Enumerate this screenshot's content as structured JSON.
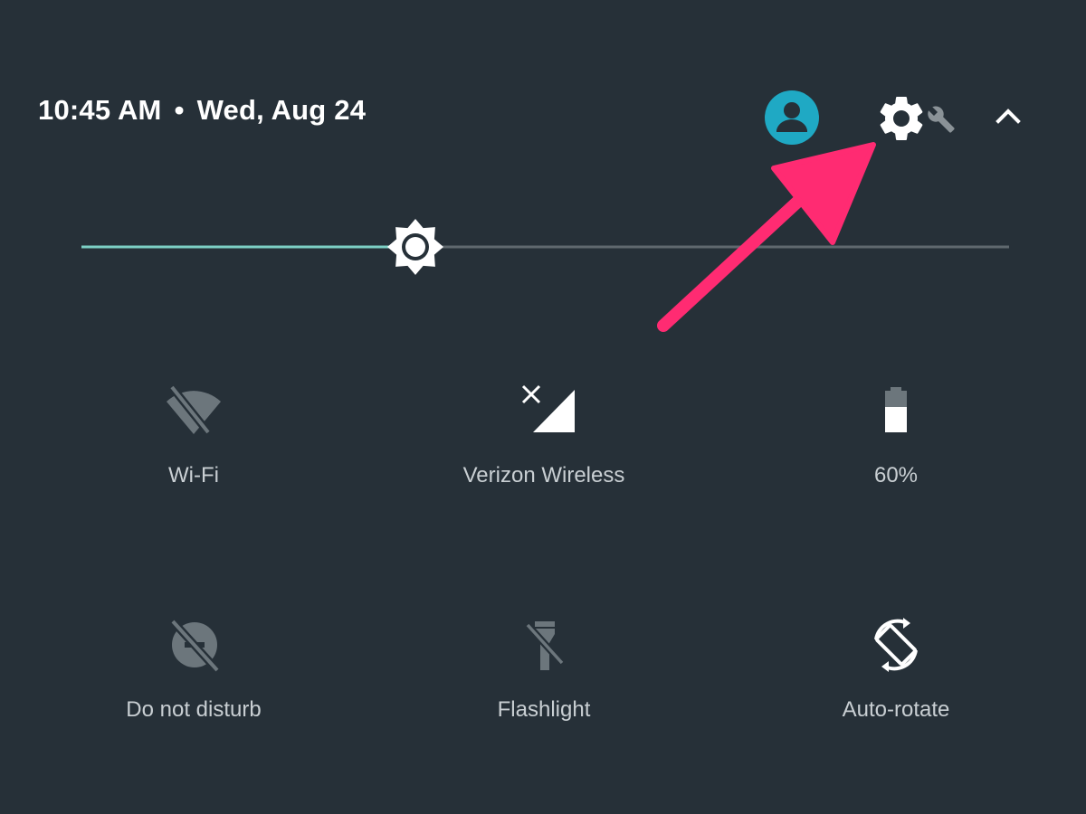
{
  "header": {
    "time": "10:45 AM",
    "separator": "•",
    "date": "Wed, Aug 24",
    "icons": {
      "user": "user-account-icon",
      "settings": "settings-gear-icon",
      "wrench": "wrench-icon",
      "collapse": "chevron-up-icon"
    }
  },
  "brightness": {
    "level": 0.36,
    "icon": "brightness-icon"
  },
  "tiles": [
    {
      "label": "Wi-Fi",
      "icon": "wifi-off-icon",
      "active": false
    },
    {
      "label": "Verizon Wireless",
      "icon": "cell-signal-no-data-icon",
      "active": true
    },
    {
      "label": "60%",
      "icon": "battery-icon",
      "active": true
    },
    {
      "label": "Do not disturb",
      "icon": "do-not-disturb-off-icon",
      "active": false
    },
    {
      "label": "Flashlight",
      "icon": "flashlight-off-icon",
      "active": false
    },
    {
      "label": "Auto-rotate",
      "icon": "auto-rotate-icon",
      "active": true
    }
  ],
  "colors": {
    "background": "#263038",
    "accent_teal": "#7ccfc4",
    "avatar_teal": "#1fa9c4",
    "inactive_icon": "#6c767c",
    "annotation_arrow": "#ff2b72"
  }
}
